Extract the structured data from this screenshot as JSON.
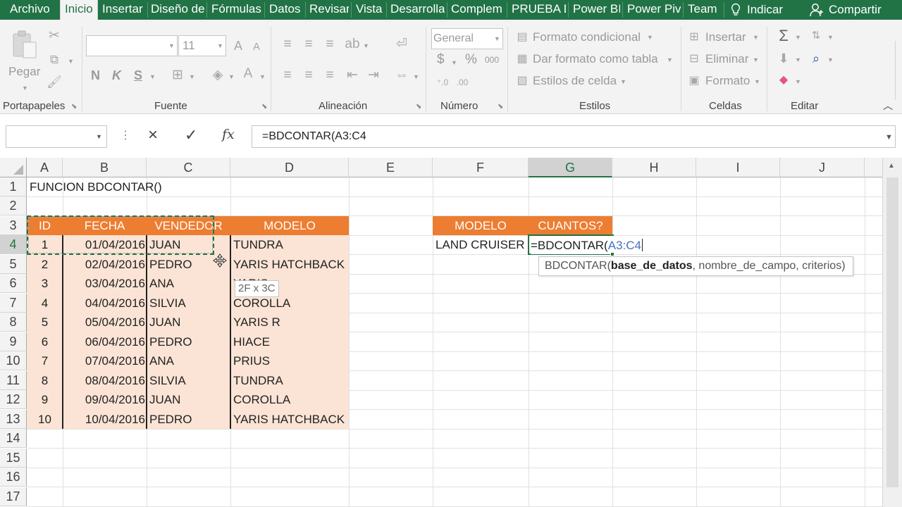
{
  "ribbon_tabs": [
    "Archivo",
    "Inicio",
    "Insertar",
    "Diseño de",
    "Fórmulas",
    "Datos",
    "Revisar",
    "Vista",
    "Desarrolla",
    "Complem",
    "PRUEBA D",
    "Power BI",
    "Power Piv",
    "Team"
  ],
  "active_tab": "Inicio",
  "tell_me": "Indicar",
  "share": "Compartir",
  "ribbon": {
    "paste_label": "Pegar",
    "font_size": "11",
    "bold": "N",
    "italic": "K",
    "underline": "S",
    "number_format": "General",
    "currency": "$",
    "percent": "%",
    "thousands": "000",
    "cond_format": "Formato condicional",
    "format_table": "Dar formato como tabla",
    "cell_styles": "Estilos de celda",
    "insert": "Insertar",
    "delete": "Eliminar",
    "format": "Formato",
    "groups": {
      "clipboard": "Portapapeles",
      "font": "Fuente",
      "alignment": "Alineación",
      "number": "Número",
      "styles": "Estilos",
      "cells": "Celdas",
      "edit": "Editar"
    }
  },
  "formula_bar": {
    "name_box": "",
    "cancel_icon": "×",
    "enter_icon": "✓",
    "fx": "fx",
    "formula": "=BDCONTAR(A3:C4"
  },
  "columns": [
    "A",
    "B",
    "C",
    "D",
    "E",
    "F",
    "G",
    "H",
    "I",
    "J"
  ],
  "rows": [
    "1",
    "2",
    "3",
    "4",
    "5",
    "6",
    "7",
    "8",
    "9",
    "10",
    "11",
    "12",
    "13",
    "14",
    "15",
    "16",
    "17"
  ],
  "title": "FUNCION BDCONTAR()",
  "table": {
    "headers": [
      "ID",
      "FECHA",
      "VENDEDOR",
      "MODELO"
    ],
    "rows": [
      [
        "1",
        "01/04/2016",
        "JUAN",
        "TUNDRA"
      ],
      [
        "2",
        "02/04/2016",
        "PEDRO",
        "YARIS HATCHBACK"
      ],
      [
        "3",
        "03/04/2016",
        "ANA",
        "YARIS"
      ],
      [
        "4",
        "04/04/2016",
        "SILVIA",
        "COROLLA"
      ],
      [
        "5",
        "05/04/2016",
        "JUAN",
        "YARIS R"
      ],
      [
        "6",
        "06/04/2016",
        "PEDRO",
        "HIACE"
      ],
      [
        "7",
        "07/04/2016",
        "ANA",
        "PRIUS"
      ],
      [
        "8",
        "08/04/2016",
        "SILVIA",
        "TUNDRA"
      ],
      [
        "9",
        "09/04/2016",
        "JUAN",
        "COROLLA"
      ],
      [
        "10",
        "10/04/2016",
        "PEDRO",
        "YARIS HATCHBACK"
      ]
    ]
  },
  "criteria": {
    "headers": [
      "MODELO",
      "CUANTOS?"
    ],
    "model": "LAND CRUISER",
    "editing_prefix": "=BDCONTAR(",
    "editing_ref": "A3:C4"
  },
  "tooltip": {
    "func": "BDCONTAR(",
    "arg1": "base_de_datos",
    "rest": ", nombre_de_campo, criterios)"
  },
  "size_tip": "2F x 3C",
  "colors": {
    "excel_green": "#217346",
    "header_orange": "#ed7d31",
    "body_peach": "#fbe4d5",
    "ref_blue": "#4472c4"
  }
}
